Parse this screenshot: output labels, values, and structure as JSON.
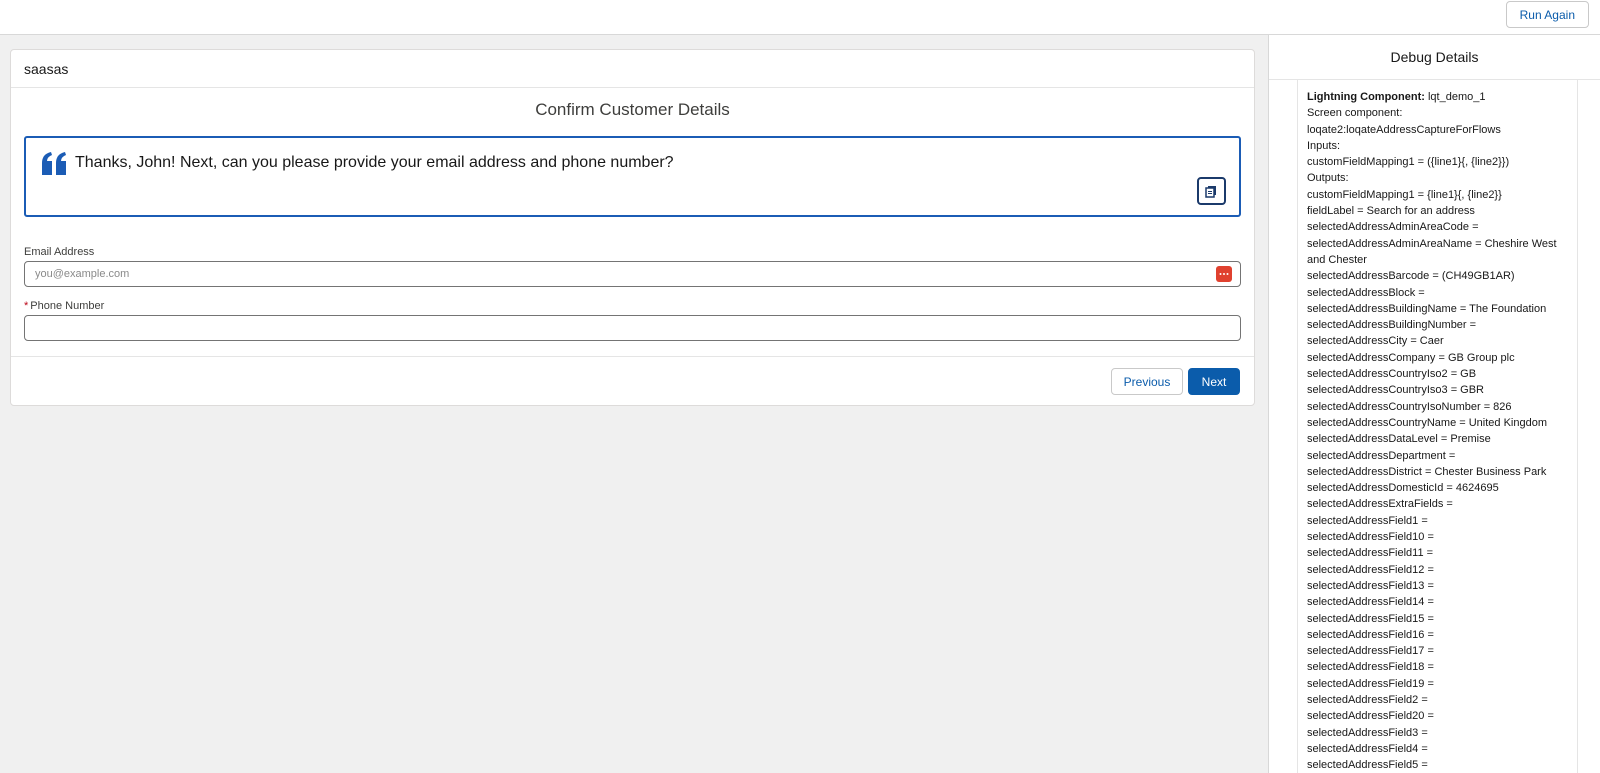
{
  "topbar": {
    "run_again_label": "Run Again"
  },
  "screen": {
    "header": "saasas",
    "title": "Confirm Customer Details",
    "message": "Thanks, John! Next, can you please provide your email address and phone number?",
    "email": {
      "label": "Email Address",
      "placeholder": "you@example.com",
      "value": ""
    },
    "phone": {
      "label": "Phone Number",
      "required_marker": "*",
      "value": ""
    },
    "previous_label": "Previous",
    "next_label": "Next"
  },
  "debug": {
    "title": "Debug Details",
    "component_label": "Lightning Component:",
    "component_value": " lqt_demo_1",
    "lines": [
      "Screen component:",
      "loqate2:loqateAddressCaptureForFlows",
      "Inputs:",
      "customFieldMapping1 = ({line1}{, {line2}})",
      "Outputs:",
      "customFieldMapping1 = {line1}{, {line2}}",
      "fieldLabel = Search for an address",
      "selectedAddressAdminAreaCode =",
      "selectedAddressAdminAreaName = Cheshire West and Chester",
      "selectedAddressBarcode = (CH49GB1AR)",
      "selectedAddressBlock =",
      "selectedAddressBuildingName = The Foundation",
      "selectedAddressBuildingNumber =",
      "selectedAddressCity = Caer",
      "selectedAddressCompany = GB Group plc",
      "selectedAddressCountryIso2 = GB",
      "selectedAddressCountryIso3 = GBR",
      "selectedAddressCountryIsoNumber = 826",
      "selectedAddressCountryName = United Kingdom",
      "selectedAddressDataLevel = Premise",
      "selectedAddressDepartment =",
      "selectedAddressDistrict = Chester Business Park",
      "selectedAddressDomesticId = 4624695",
      "selectedAddressExtraFields =",
      "selectedAddressField1 =",
      "selectedAddressField10 =",
      "selectedAddressField11 =",
      "selectedAddressField12 =",
      "selectedAddressField13 =",
      "selectedAddressField14 =",
      "selectedAddressField15 =",
      "selectedAddressField16 =",
      "selectedAddressField17 =",
      "selectedAddressField18 =",
      "selectedAddressField19 =",
      "selectedAddressField2 =",
      "selectedAddressField20 =",
      "selectedAddressField3 =",
      "selectedAddressField4 =",
      "selectedAddressField5 ="
    ]
  },
  "colors": {
    "brand_blue": "#0b5cab",
    "quote_border": "#1b5cb5",
    "password_manager_icon": "#e0412f"
  },
  "icons": {
    "quote": "quote-icon",
    "copy": "copy-icon",
    "password_manager": "password-manager-icon"
  }
}
